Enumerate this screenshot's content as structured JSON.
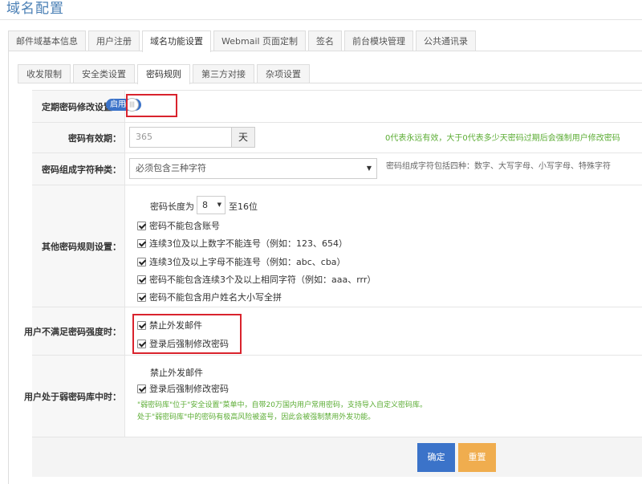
{
  "page_title": "域名配置",
  "tabs": [
    "邮件域基本信息",
    "用户注册",
    "域名功能设置",
    "Webmail 页面定制",
    "签名",
    "前台模块管理",
    "公共通讯录"
  ],
  "subtabs": [
    "收发限制",
    "安全类设置",
    "密码规则",
    "第三方对接",
    "杂项设置"
  ],
  "periodic_change": {
    "label": "定期密码修改设置：",
    "toggle_text": "启用"
  },
  "validity": {
    "label": "密码有效期：",
    "value": "365",
    "unit": "天",
    "hint": "0代表永远有效，大于0代表多少天密码过期后会强制用户修改密码"
  },
  "char_types": {
    "label": "密码组成字符种类：",
    "selected": "必须包含三种字符",
    "hint": "密码组成字符包括四种：数字、大写字母、小写字母、特殊字符"
  },
  "other_rules": {
    "label": "其他密码规则设置：",
    "length_prefix": "密码长度为",
    "length_value": "8",
    "length_suffix": "至16位",
    "items": [
      "密码不能包含账号",
      "连续3位及以上数字不能连号（例如：123、654）",
      "连续3位及以上字母不能连号（例如：abc、cba）",
      "密码不能包含连续3个及以上相同字符（例如：aaa、rrr）",
      "密码不能包含用户姓名大小写全拼"
    ]
  },
  "weak_strength": {
    "label": "用户不满足密码强度时：",
    "items": [
      "禁止外发邮件",
      "登录后强制修改密码"
    ]
  },
  "weak_db": {
    "label": "用户处于弱密码库中时：",
    "item_unchecked": "禁止外发邮件",
    "item_checked": "登录后强制修改密码",
    "note1": "\"弱密码库\"位于\"安全设置\"菜单中，自带20万国内用户常用密码，支持导入自定义密码库。",
    "note2": "处于\"弱密码库\"中的密码有极高风险被盗号，因此会被强制禁用外发功能。"
  },
  "buttons": {
    "confirm": "确定",
    "reset": "重置"
  },
  "colors": {
    "primary": "#3b73c9",
    "warning": "#f0ad4e",
    "hint_green": "#5cad35",
    "highlight_red": "#d9232d"
  }
}
